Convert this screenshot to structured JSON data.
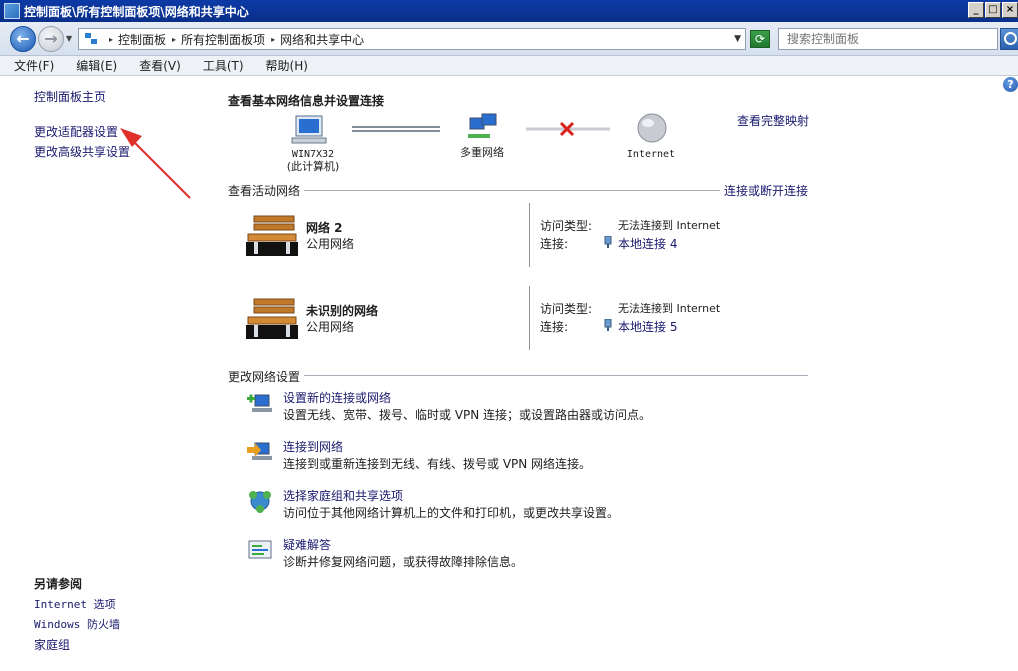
{
  "window": {
    "title": "控制面板\\所有控制面板项\\网络和共享中心",
    "buttons": [
      "_",
      "□",
      "×"
    ]
  },
  "address": {
    "crumbs": [
      "控制面板",
      "所有控制面板项",
      "网络和共享中心"
    ],
    "search_placeholder": "搜索控制面板"
  },
  "menu": [
    "文件(F)",
    "编辑(E)",
    "查看(V)",
    "工具(T)",
    "帮助(H)"
  ],
  "left": {
    "home": "控制面板主页",
    "links": [
      "更改适配器设置",
      "更改高级共享设置"
    ],
    "see_also_title": "另请参阅",
    "see_also": [
      "Internet 选项",
      "Windows 防火墙",
      "家庭组"
    ]
  },
  "main": {
    "title": "查看基本网络信息并设置连接",
    "full_map": "查看完整映射",
    "nodes": [
      {
        "label": "WIN7X32",
        "sub": "(此计算机)"
      },
      {
        "label": "多重网络",
        "sub": ""
      },
      {
        "label": "Internet",
        "sub": ""
      }
    ],
    "active_title": "查看活动网络",
    "connect_disconnect": "连接或断开连接",
    "networks": [
      {
        "name": "网络  2",
        "type": "公用网络",
        "access_label": "访问类型:",
        "access_value": "无法连接到 Internet",
        "conn_label": "连接:",
        "conn_value": "本地连接 4"
      },
      {
        "name": "未识别的网络",
        "type": "公用网络",
        "access_label": "访问类型:",
        "access_value": "无法连接到 Internet",
        "conn_label": "连接:",
        "conn_value": "本地连接 5"
      }
    ],
    "change_title": "更改网络设置",
    "tasks": [
      {
        "title": "设置新的连接或网络",
        "desc": "设置无线、宽带、拨号、临时或 VPN 连接；或设置路由器或访问点。"
      },
      {
        "title": "连接到网络",
        "desc": "连接到或重新连接到无线、有线、拨号或 VPN 网络连接。"
      },
      {
        "title": "选择家庭组和共享选项",
        "desc": "访问位于其他网络计算机上的文件和打印机，或更改共享设置。"
      },
      {
        "title": "疑难解答",
        "desc": "诊断并修复网络问题，或获得故障排除信息。"
      }
    ]
  },
  "help_icon": "?"
}
